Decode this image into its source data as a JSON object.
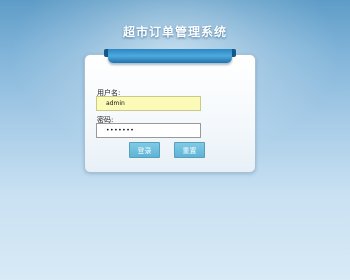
{
  "header": {
    "title": "超市订单管理系统"
  },
  "login_form": {
    "username_label": "用户名:",
    "username_value": "admin",
    "password_label": "密码:",
    "password_masked": "•••••••",
    "login_button": "登录",
    "reset_button": "重置"
  }
}
